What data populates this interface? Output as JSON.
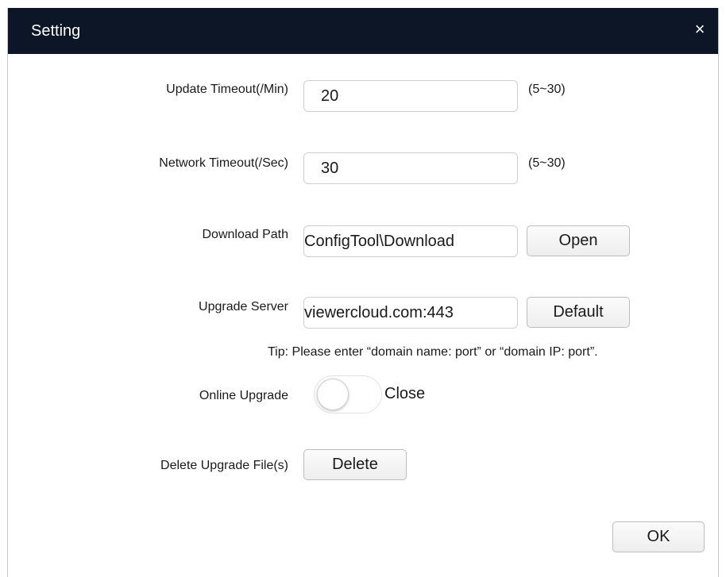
{
  "dialog": {
    "title": "Setting",
    "close_glyph": "×"
  },
  "settings": {
    "update_timeout": {
      "label": "Update Timeout(/Min)",
      "value": "20",
      "range": "(5~30)"
    },
    "network_timeout": {
      "label": "Network Timeout(/Sec)",
      "value": "30",
      "range": "(5~30)"
    },
    "download_path": {
      "label": "Download Path",
      "value": "ConfigTool\\Download",
      "button": "Open"
    },
    "upgrade_server": {
      "label": "Upgrade Server",
      "value": "viewercloud.com:443",
      "button": "Default",
      "tip": "Tip: Please enter “domain name: port” or “domain IP: port”."
    },
    "online_upgrade": {
      "label": "Online Upgrade",
      "state": "Close",
      "enabled": false
    },
    "delete_files": {
      "label": "Delete Upgrade File(s)",
      "button": "Delete"
    }
  },
  "footer": {
    "ok_label": "OK"
  },
  "colors": {
    "titlebar": "#0d1627",
    "title_text": "#ffffff"
  }
}
